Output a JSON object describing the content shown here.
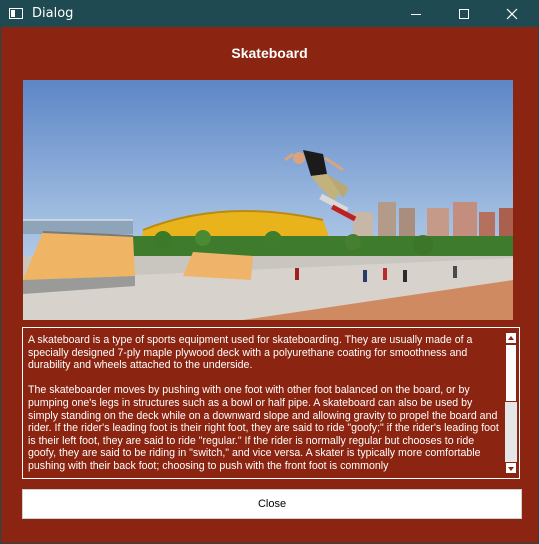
{
  "window": {
    "title": "Dialog",
    "colors": {
      "titlebar": "#1f4a52",
      "background": "#8b2410",
      "text": "#ffffff"
    }
  },
  "titlebar_buttons": {
    "minimize_icon": "minimize-icon",
    "maximize_icon": "maximize-icon",
    "close_icon": "close-icon"
  },
  "content": {
    "heading": "Skateboard",
    "image_description": "skateboarder-jumping-photo",
    "paragraphs": [
      "A skateboard is a type of sports equipment used for skateboarding. They are usually made of a specially designed 7-ply maple plywood deck with a polyurethane coating for smoothness and durability and wheels attached to the underside.",
      "The skateboarder moves by pushing with one foot with other foot balanced on the board, or by pumping one's legs in structures such as a bowl or half pipe. A skateboard can also be used by simply standing on the deck while on a downward slope and allowing gravity to propel the board and rider. If the rider's leading foot is their right foot, they are said to ride \"goofy;\" if the rider's leading foot is their left foot, they are said to ride \"regular.\" If the rider is normally regular but chooses to ride goofy, they are said to be riding in \"switch,\" and vice versa. A skater is typically more comfortable pushing with their back foot; choosing to push with the front foot is commonly"
    ]
  },
  "scrollbar": {
    "position_fraction": 0.0
  },
  "footer": {
    "close_label": "Close"
  }
}
